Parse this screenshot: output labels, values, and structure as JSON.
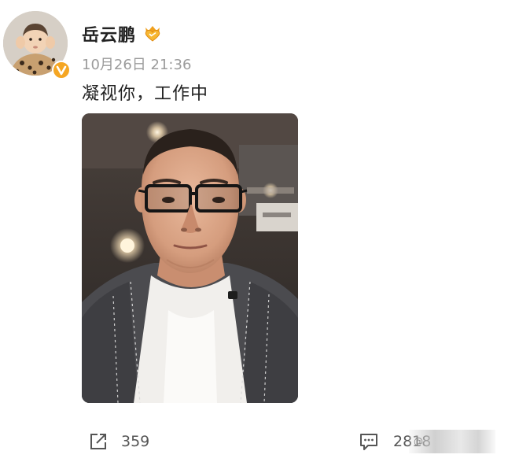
{
  "post": {
    "username": "岳云鹏",
    "timestamp": "10月26日 21:36",
    "text": "凝视你，工作中",
    "photo_subject": "selfie-man-glasses"
  },
  "icons": {
    "verified": "verified-v-icon",
    "vip": "vip-heart-crown-icon",
    "repost": "repost-icon",
    "comment": "comment-icon"
  },
  "actions": {
    "repost_count": "359",
    "comment_count": "2818"
  },
  "colors": {
    "verified_badge": "#f5a623",
    "vip_icon": "#f0a01e",
    "text_primary": "#222222",
    "text_secondary": "#9b9b9b"
  }
}
